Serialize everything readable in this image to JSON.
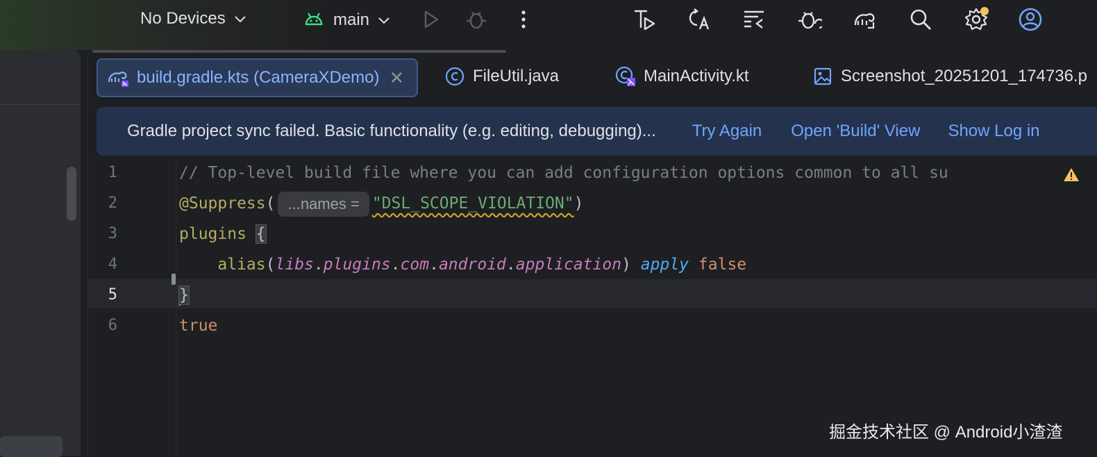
{
  "toolbar": {
    "devices_label": "No Devices",
    "branch_label": "main",
    "icons": [
      "run-icon",
      "debug-icon",
      "more-icon",
      "run-test-icon",
      "translate-icon",
      "git-changes-icon",
      "bug-sync-icon",
      "gradle-sync-icon",
      "search-icon",
      "settings-icon",
      "account-icon"
    ],
    "settings_badge_color": "#f2c55c",
    "android_icon_color": "#3ddc84"
  },
  "tabs": [
    {
      "label": "build.gradle.kts (CameraXDemo)",
      "icon": "gradle-kts-icon",
      "active": true
    },
    {
      "label": "FileUtil.java",
      "icon": "java-class-icon",
      "active": false
    },
    {
      "label": "MainActivity.kt",
      "icon": "kotlin-class-icon",
      "active": false
    },
    {
      "label": "Screenshot_20251201_174736.p",
      "icon": "image-file-icon",
      "active": false
    }
  ],
  "banner": {
    "message": "Gradle project sync failed. Basic functionality (e.g. editing, debugging)...",
    "try_again": "Try Again",
    "open_build": "Open 'Build' View",
    "show_log": "Show Log in"
  },
  "code": {
    "line_numbers": [
      "1",
      "2",
      "3",
      "4",
      "5",
      "6"
    ],
    "current_line": "5",
    "line1": "// Top-level build file where you can add configuration options common to all su",
    "line2_annotation": "@Suppress",
    "line2_open": "(",
    "line2_hint": "...names =",
    "line2_string": "\"DSL_SCOPE_VIOLATION\"",
    "line2_close": ")",
    "line3_plugins": "plugins",
    "line3_brace": "{",
    "line4_alias": "alias",
    "line4_open": "(",
    "line4_libs": "libs",
    "line4_plugins": "plugins",
    "line4_com": "com",
    "line4_android": "android",
    "line4_application": "application",
    "line4_close": ")",
    "line4_apply": "apply",
    "line4_false": "false",
    "line5_brace": "}",
    "line6_true": "true"
  },
  "watermark": "掘金技术社区 @ Android小渣渣"
}
